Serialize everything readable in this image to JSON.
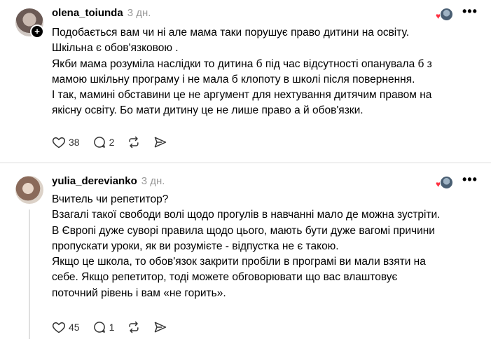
{
  "posts": [
    {
      "username": "olena_toiunda",
      "time": "3 дн.",
      "lines": [
        "Подобається вам чи ні але мама таки порушує право дитини на освіту.",
        "Шкільна є обов'язковою .",
        "Якби мама розуміла наслідки то дитина б під час відсутності опанувала б з",
        "мамою шкільну програму і не мала б клопоту в школі після повернення.",
        "І так, мамині обставини це не аргумент для нехтування дитячим правом на",
        "якісну освіту. Бо мати дитину це не лише право а й обов'язки."
      ],
      "likes": "38",
      "replies": "2"
    },
    {
      "username": "yulia_derevianko",
      "time": "3 дн.",
      "lines": [
        "Вчитель чи репетитор?",
        "Взагалі такої свободи волі щодо прогулів в навчанні мало де можна зустріти.",
        "В Європі дуже суворі правила щодо цього, мають бути дуже вагомі причини",
        "пропускати уроки, як ви розумієте - відпустка не є такою.",
        "Якщо це школа, то обов'язок закрити пробіли в програмі ви мали взяти на",
        "себе. Якщо репетитор, тоді можете обговорювати що вас влаштовує",
        "поточний рівень і вам «не горить»."
      ],
      "likes": "45",
      "replies": "1"
    }
  ],
  "icons": {
    "more": "•••",
    "plus": "+",
    "heart": "♥"
  },
  "colors": {
    "like_badge": "#ff3040",
    "meta": "#999999",
    "divider": "#dcdcdc"
  }
}
